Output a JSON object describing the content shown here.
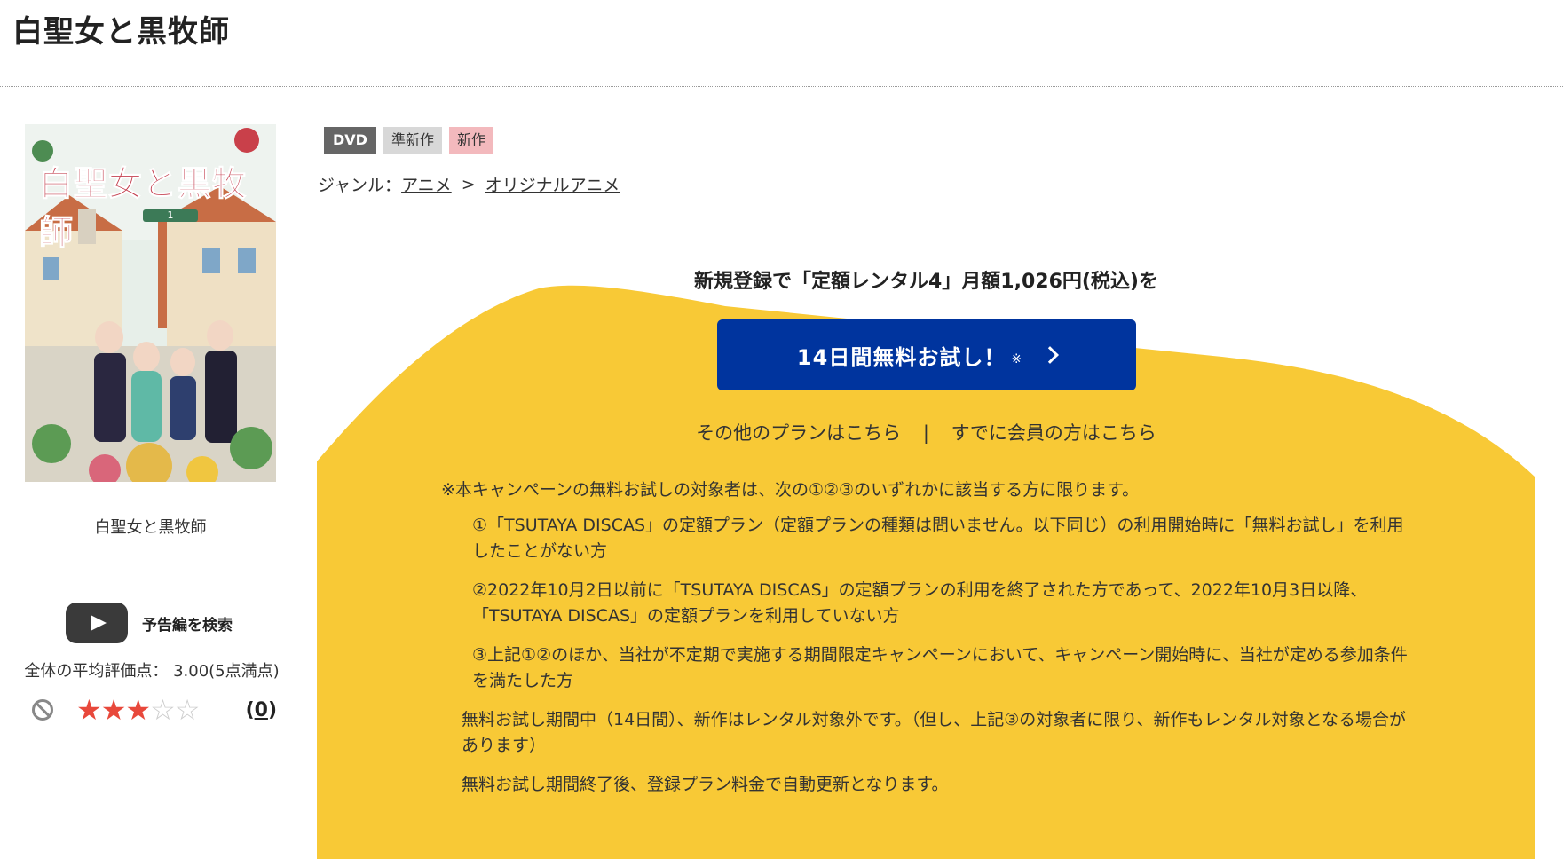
{
  "page": {
    "title": "白聖女と黒牧師"
  },
  "jacket": {
    "title_art": "白聖女と黒牧師",
    "volume": "1"
  },
  "item": {
    "title": "白聖女と黒牧師"
  },
  "trailer": {
    "label": "予告編を検索"
  },
  "rating": {
    "text": "全体の平均評価点： 3.00(5点満点)",
    "score": 3.0,
    "max": 5,
    "review_count": "0"
  },
  "tags": {
    "dvd": "DVD",
    "semi_new": "準新作",
    "new": "新作"
  },
  "genre": {
    "label": "ジャンル：",
    "level1": "アニメ",
    "separator": ">",
    "level2": "オリジナルアニメ"
  },
  "campaign": {
    "headline": "新規登録で「定額レンタル4」月額1,026円(税込)を",
    "button_label": "14日間無料お試し！",
    "button_note": "※",
    "other_plans": "その他のプランはこちら",
    "link_separator": "|",
    "member_login": "すでに会員の方はこちら"
  },
  "notes": {
    "lead": "※本キャンペーンの無料お試しの対象者は、次の①②③のいずれかに該当する方に限ります。",
    "item1": "①「TSUTAYA DISCAS」の定額プラン（定額プランの種類は問いません。以下同じ）の利用開始時に「無料お試し」を利用したことがない方",
    "item2": "②2022年10月2日以前に「TSUTAYA DISCAS」の定額プランの利用を終了された方であって、2022年10月3日以降、「TSUTAYA DISCAS」の定額プランを利用していない方",
    "item3": "③上記①②のほか、当社が不定期で実施する期間限定キャンペーンにおいて、キャンペーン開始時に、当社が定める参加条件を満たした方",
    "period": "無料お試し期間中（14日間）、新作はレンタル対象外です。（但し、上記③の対象者に限り、新作もレンタル対象となる場合があります）",
    "renewal": "無料お試し期間終了後、登録プラン料金で自動更新となります。"
  },
  "colors": {
    "accent_yellow": "#f8c936",
    "button_blue": "#00349e",
    "star_on": "#e8483b"
  }
}
